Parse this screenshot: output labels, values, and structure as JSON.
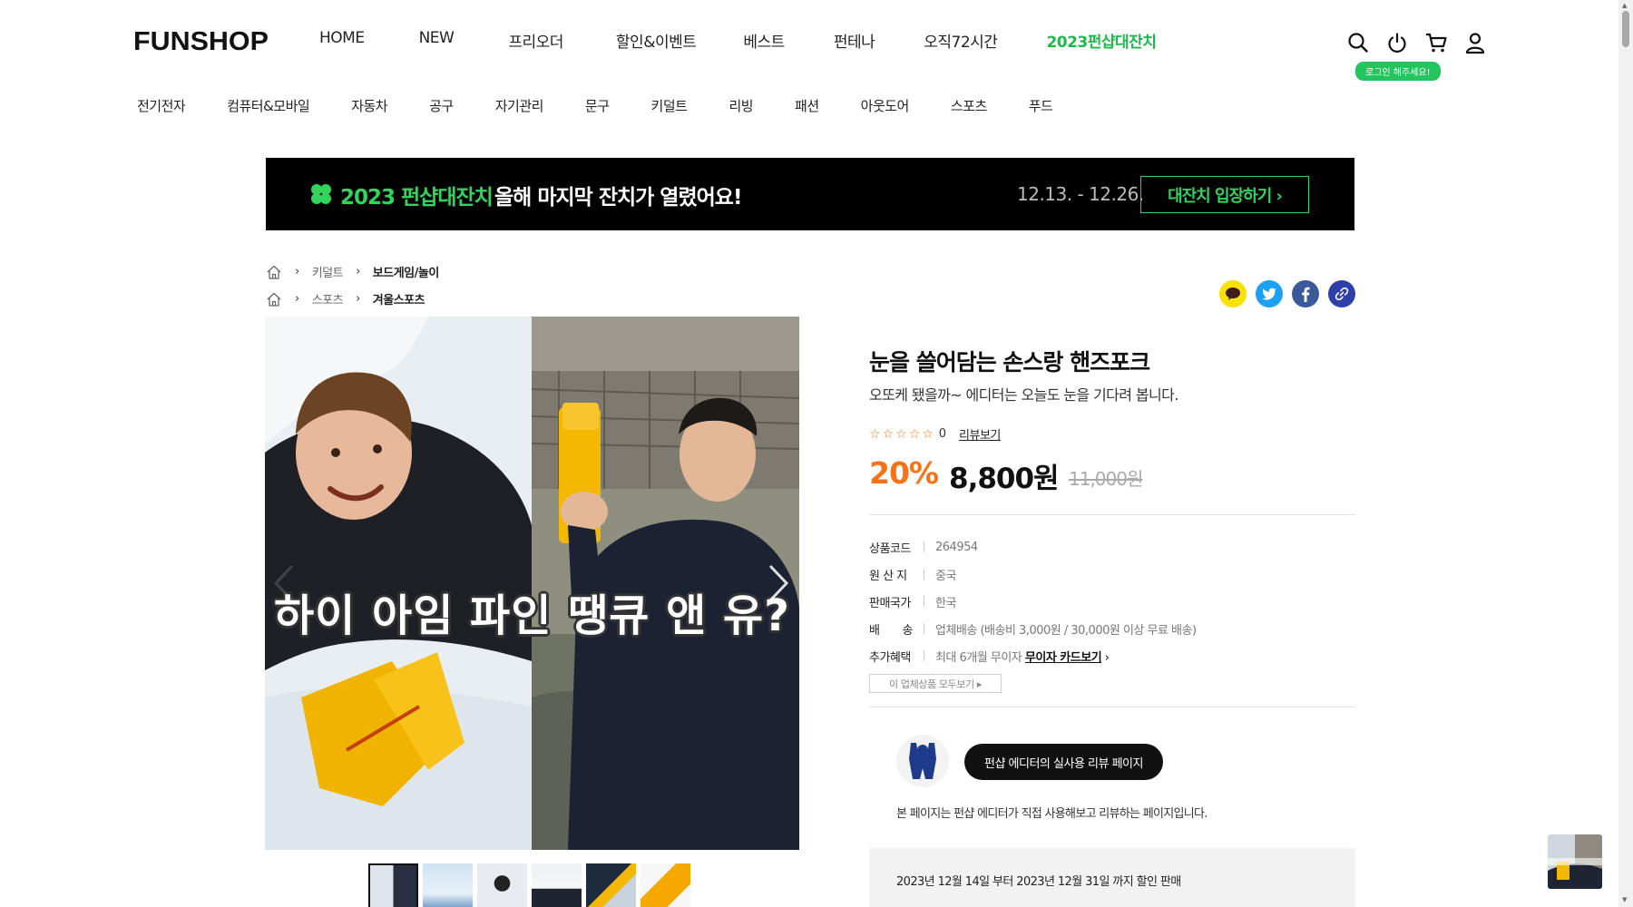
{
  "brand": "FUNSHOP",
  "gnb": [
    "HOME",
    "NEW",
    "프리오더",
    "할인&이벤트",
    "베스트",
    "펀테나",
    "오직72시간",
    "2023펀샵대잔치"
  ],
  "util": {
    "login_tip": "로그인 해주세요!"
  },
  "categories": [
    "전기전자",
    "컴퓨터&모바일",
    "자동차",
    "공구",
    "자기관리",
    "문구",
    "키덜트",
    "리빙",
    "패션",
    "아웃도어",
    "스포츠",
    "푸드"
  ],
  "banner": {
    "title_green": "2023 펀샵대잔치",
    "title_white": "올해 마지막 잔치가 열렸어요!",
    "dates": "12.13. - 12.26.",
    "button": "대잔치 입장하기 ›"
  },
  "breadcrumbs": [
    {
      "c1": "키덜트",
      "c2": "보드게임/놀이"
    },
    {
      "c1": "스포츠",
      "c2": "겨울스포츠"
    }
  ],
  "image": {
    "caption": "하이 아임 파인 땡큐 앤 유?"
  },
  "product": {
    "title": "눈을 쓸어담는 손스랑 핸즈포크",
    "subtitle": "오또케 됐을까~ 에디터는 오늘도 눈을 기다려 봅니다.",
    "stars": "☆☆☆☆☆",
    "rating_count": "0",
    "review_link": "리뷰보기",
    "discount": "20%",
    "price": "8,800원",
    "original_price": "11,000원"
  },
  "spec": [
    {
      "k": "상품코드",
      "v": "264954"
    },
    {
      "k": "원 산 지",
      "v": "중국"
    },
    {
      "k": "판매국가",
      "v": "한국"
    },
    {
      "k": "배　　송",
      "v": "업체배송 (배송비 3,000원 / 30,000원 이상 무료 배송)"
    },
    {
      "k": "추가혜택",
      "v": "최대 6개월 무이자",
      "link": "무이자 카드보기",
      "arrow": "›"
    }
  ],
  "all_products_button": "이 업체상품 모두보기 ▸",
  "editor": {
    "button": "펀샵 에디터의 실사용 리뷰 페이지",
    "note": "본 페이지는 펀샵 에디터가 직접 사용해보고 리뷰하는 페이지입니다."
  },
  "notice": "2023년 12월 14일 부터 2023년 12월 31일 까지 할인 판매",
  "colors": {
    "accent_green": "#1fb84d",
    "discount_orange": "#f97316",
    "banner_bg": "#000000"
  }
}
